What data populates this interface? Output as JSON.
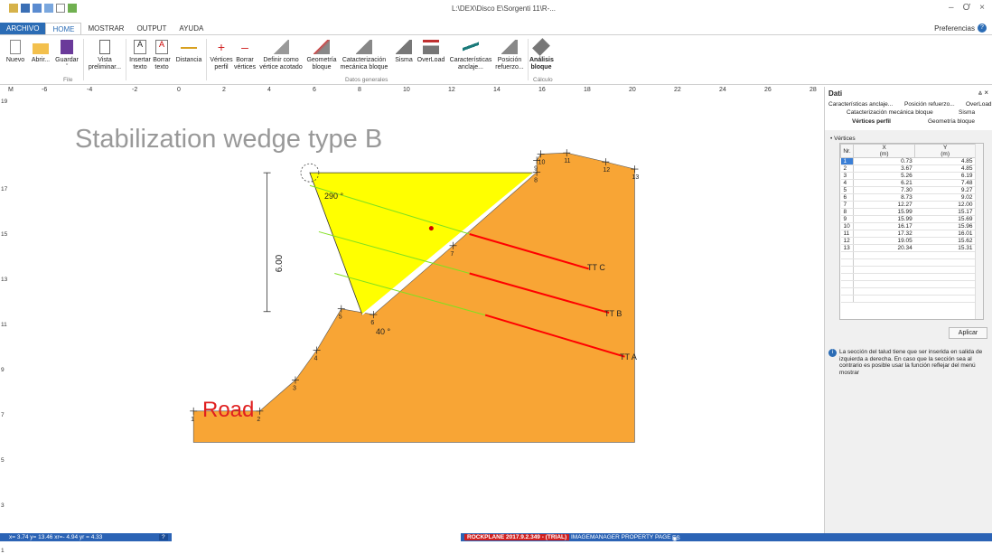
{
  "window": {
    "title": "L:\\DEX\\Disco E\\Sorgenti 11\\R-...",
    "min": "–",
    "restore": "Ơ",
    "close": "×"
  },
  "tabs": [
    "ARCHIVO",
    "HOME",
    "MOSTRAR",
    "OUTPUT",
    "AYUDA"
  ],
  "preferences": "Preferencias",
  "ribbon": {
    "buttons": [
      {
        "l1": "Nuevo",
        "l2": "",
        "icon": "new-file-icon"
      },
      {
        "l1": "Abrir...",
        "l2": "",
        "icon": "open-folder-icon"
      },
      {
        "l1": "Guardar",
        "l2": "ˇ",
        "icon": "save-icon"
      },
      {
        "l1": "Vista",
        "l2": "preliminar...",
        "icon": "print-preview-icon"
      },
      {
        "l1": "Insertar",
        "l2": "texto",
        "icon": "insert-text-icon"
      },
      {
        "l1": "Borrar",
        "l2": "texto",
        "icon": "delete-text-icon"
      },
      {
        "l1": "Distancia",
        "l2": "",
        "icon": "distance-icon"
      },
      {
        "l1": "Vértices",
        "l2": "perfil",
        "icon": "add-vertex-icon"
      },
      {
        "l1": "Borrar",
        "l2": "vértices",
        "icon": "delete-vertex-icon"
      },
      {
        "l1": "Definir como",
        "l2": "vértice acotado",
        "icon": "bounded-vertex-icon"
      },
      {
        "l1": "Geometría",
        "l2": "bloque",
        "icon": "block-geometry-icon"
      },
      {
        "l1": "Catacterización",
        "l2": "mecánica bloque",
        "icon": "block-mechanics-icon"
      },
      {
        "l1": "Sisma",
        "l2": "",
        "icon": "seismic-icon"
      },
      {
        "l1": "OverLoad",
        "l2": "",
        "icon": "overload-icon"
      },
      {
        "l1": "Características",
        "l2": "anclaje...",
        "icon": "anchor-icon"
      },
      {
        "l1": "Posición",
        "l2": "refuerzo...",
        "icon": "reinforcement-icon"
      },
      {
        "l1": "Análisis",
        "l2": "bloque",
        "icon": "block-analysis-icon"
      }
    ],
    "groups": [
      "File",
      "Datos generales",
      "Cálculo"
    ]
  },
  "ruler": {
    "corner": "M",
    "x_ticks": [
      "-6",
      "-4",
      "-2",
      "0",
      "2",
      "4",
      "6",
      "8",
      "10",
      "12",
      "14",
      "16",
      "18",
      "20",
      "22",
      "24",
      "26",
      "28"
    ],
    "y_ticks": [
      "19",
      "17",
      "15",
      "13",
      "11",
      "9",
      "7",
      "5",
      "3",
      "1"
    ]
  },
  "drawing": {
    "title": "Stabilization wedge type B",
    "road_label": "Road",
    "dimension": "6.00",
    "angle_top": "290 °",
    "angle_bottom": "40 °",
    "anchors": [
      "TT C",
      "TT B",
      "TT A"
    ],
    "vertex_labels": [
      "1",
      "2",
      "3",
      "4",
      "5",
      "6",
      "7",
      "8",
      "9",
      "10",
      "11",
      "12",
      "13"
    ],
    "colors": {
      "slope": "#f8a535",
      "wedge": "#ffff00",
      "anchor": "#ff0000",
      "grout": "#80e020"
    }
  },
  "panel": {
    "title": "Dati",
    "pin": "&#x2A53; ×",
    "tabs_row1": [
      "Características anclaje...",
      "Posición refuerzo...",
      "OverLoad"
    ],
    "tabs_row2": [
      "Catacterización mecánica bloque",
      "Sisma"
    ],
    "tabs_row3": [
      "Vértices perfil",
      "Geometría bloque"
    ],
    "section": "Vértices",
    "columns": [
      "Nr.",
      "X\n(m)",
      "Y\n(m)"
    ],
    "col_nr": "Nr.",
    "col_x": "X",
    "col_x_unit": "(m)",
    "col_y": "Y",
    "col_y_unit": "(m)",
    "rows": [
      [
        "1",
        "0.73",
        "4.85"
      ],
      [
        "2",
        "3.67",
        "4.85"
      ],
      [
        "3",
        "5.26",
        "6.19"
      ],
      [
        "4",
        "6.21",
        "7.48"
      ],
      [
        "5",
        "7.30",
        "9.27"
      ],
      [
        "6",
        "8.73",
        "9.02"
      ],
      [
        "7",
        "12.27",
        "12.00"
      ],
      [
        "8",
        "15.99",
        "15.17"
      ],
      [
        "9",
        "15.99",
        "15.69"
      ],
      [
        "10",
        "16.17",
        "15.96"
      ],
      [
        "11",
        "17.32",
        "16.01"
      ],
      [
        "12",
        "19.05",
        "15.62"
      ],
      [
        "13",
        "20.34",
        "15.31"
      ]
    ],
    "apply": "Aplicar",
    "info": "La sección  del talud tiene que ser inserida en salida de izquierda a derecha. En caso que la sección sea al contrario es posible usar la función reflejar del menú mostrar"
  },
  "status": {
    "coords": "x= 3.74 y= 13.46  xr=- 4.94 yr =  4.33",
    "help": "?",
    "product": "ROCKPLANE 2017.9.2.349 - (TRIAL)",
    "page": "IMAGEMANAGER PROPERTY PAGE",
    "lang": "ES"
  }
}
